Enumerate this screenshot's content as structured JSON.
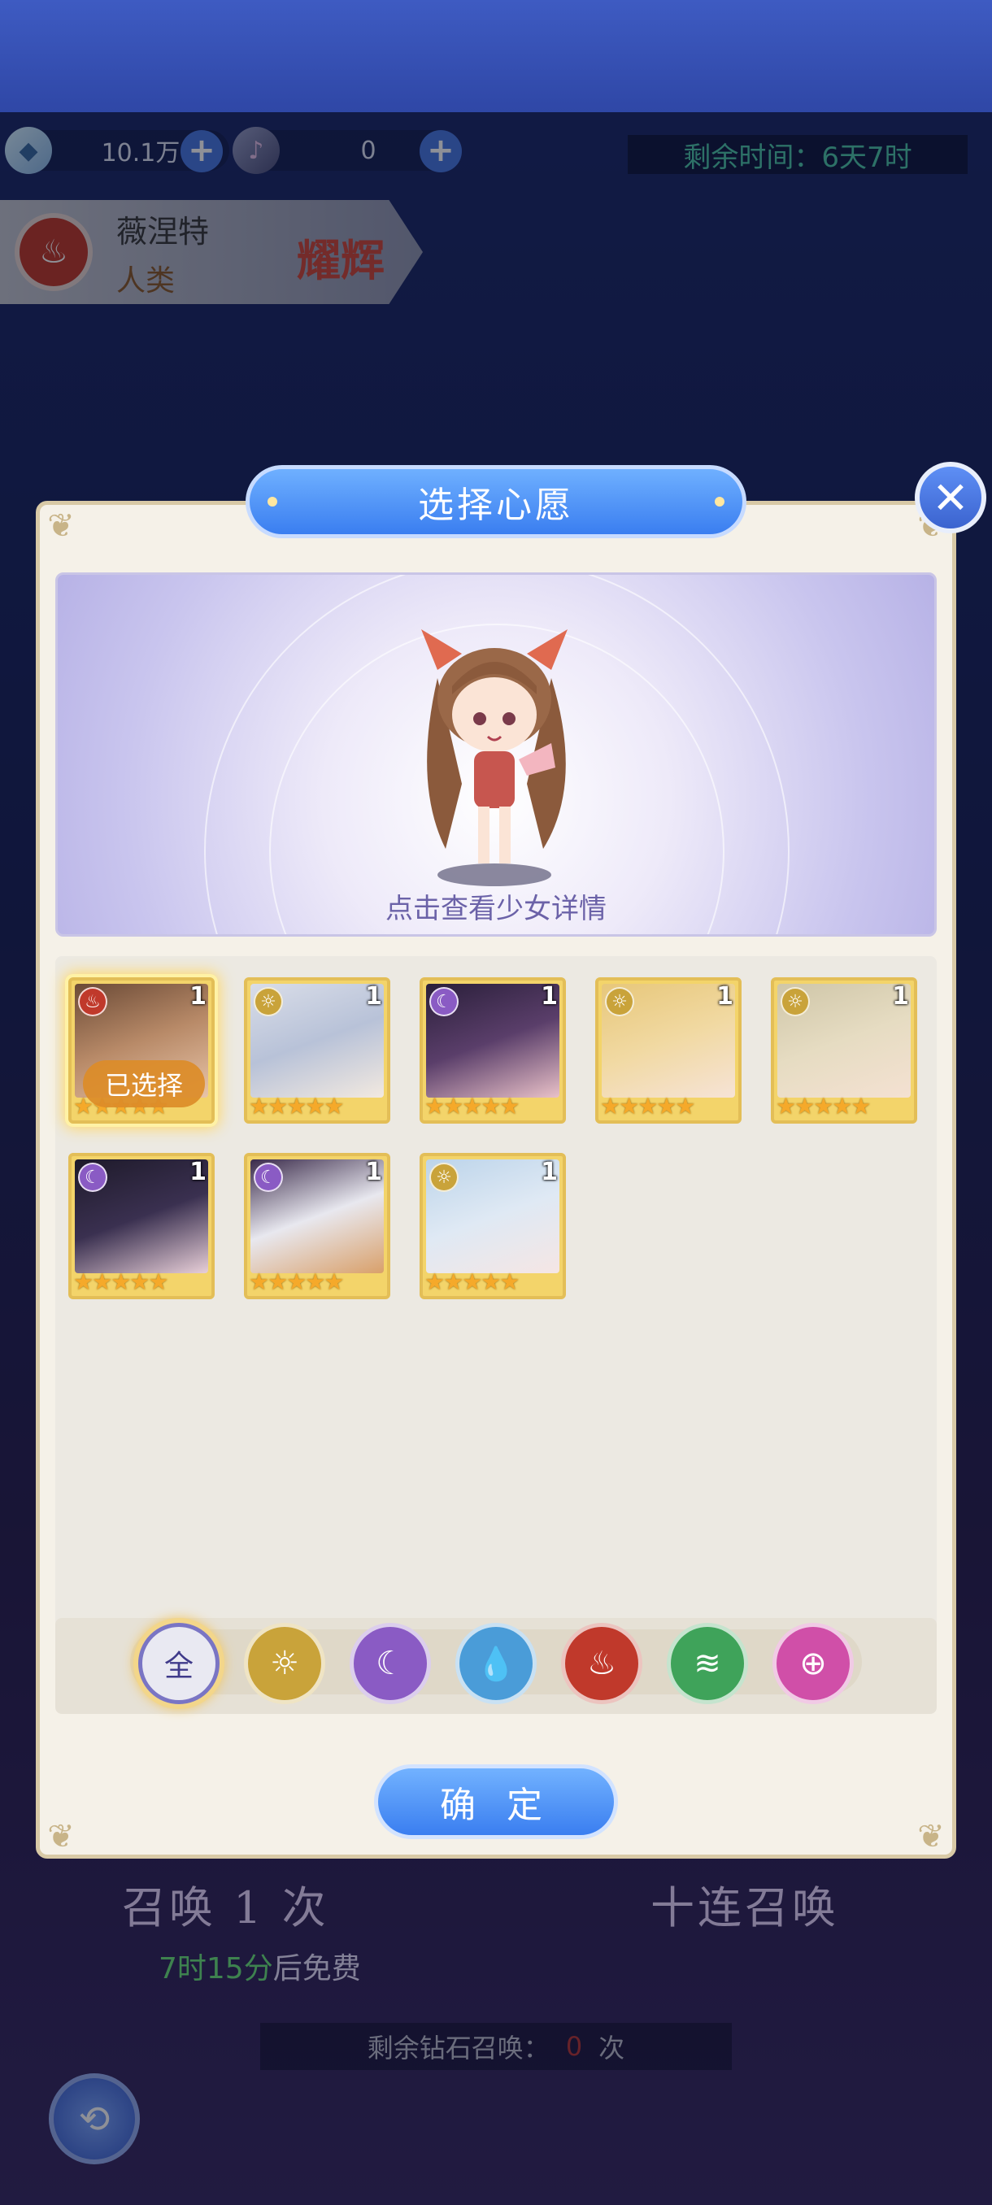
{
  "resources": [
    {
      "name": "crystal",
      "value": "10.1万",
      "icon": "crystal-icon"
    },
    {
      "name": "ticket",
      "value": "0",
      "icon": "ticket-icon"
    }
  ],
  "timer": {
    "label": "剩余时间：",
    "value": "6天7时"
  },
  "hero": {
    "name": "薇涅特",
    "race": "人类",
    "rank": "耀辉",
    "element": "fire-icon"
  },
  "modal": {
    "title": "选择心愿",
    "preview_hint": "点击查看少女详情",
    "selected_tag": "已选择",
    "confirm_label": "确 定",
    "cards": [
      {
        "element": "fire",
        "level": "1",
        "stars": "★★★★★",
        "selected": true
      },
      {
        "element": "light",
        "level": "1",
        "stars": "★★★★★"
      },
      {
        "element": "dark",
        "level": "1",
        "stars": "★★★★★"
      },
      {
        "element": "light",
        "level": "1",
        "stars": "★★★★★"
      },
      {
        "element": "light",
        "level": "1",
        "stars": "★★★★★"
      },
      {
        "element": "dark",
        "level": "1",
        "stars": "★★★★★"
      },
      {
        "element": "dark",
        "level": "1",
        "stars": "★★★★★"
      },
      {
        "element": "light",
        "level": "1",
        "stars": "★★★★★"
      }
    ],
    "filters": [
      {
        "name": "all",
        "label": "全",
        "active": true
      },
      {
        "name": "light",
        "color": "#c9a33a"
      },
      {
        "name": "dark",
        "color": "#8a5bc4"
      },
      {
        "name": "water",
        "color": "#4a9cd8"
      },
      {
        "name": "fire",
        "color": "#c0392b"
      },
      {
        "name": "wind",
        "color": "#3fa35a"
      },
      {
        "name": "cosmic",
        "color": "#d04fa8"
      }
    ]
  },
  "summon": {
    "single": "召唤 1 次",
    "ten": "十连召唤",
    "free_time": "7时15分",
    "free_suffix": "后免费",
    "diamond_prefix": "剩余钻石召唤：",
    "diamond_count": "0",
    "diamond_suffix": "次"
  }
}
